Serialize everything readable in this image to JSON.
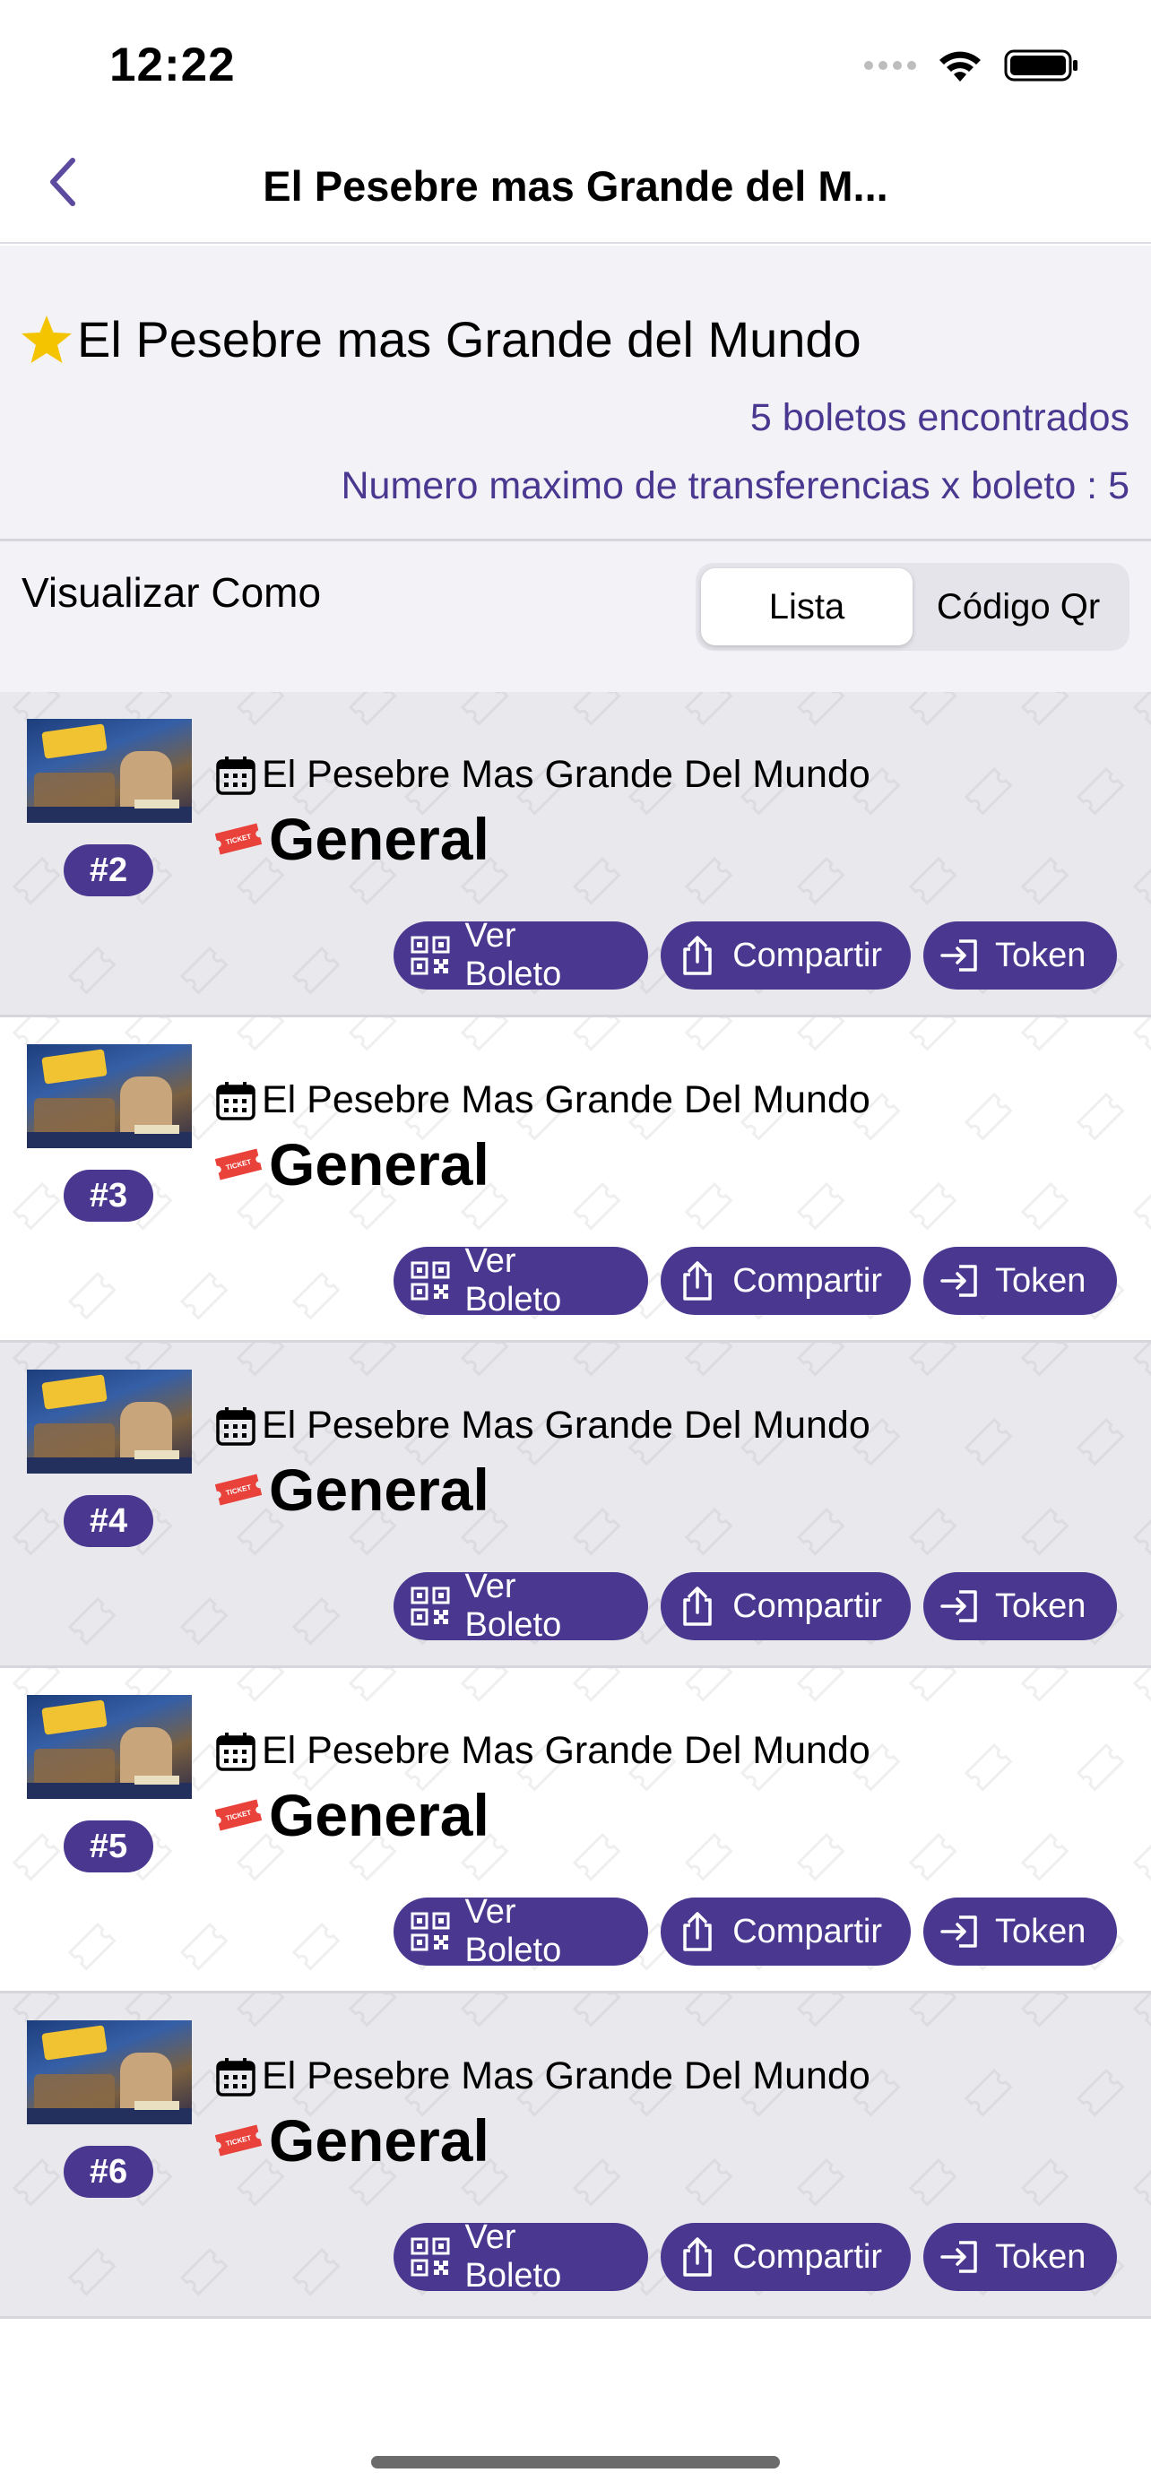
{
  "status_bar": {
    "time": "12:22"
  },
  "nav": {
    "title": "El Pesebre mas Grande del M..."
  },
  "header": {
    "event_title": "El Pesebre mas Grande del Mundo",
    "tickets_found": "5 boletos encontrados",
    "max_transfers": "Numero maximo de transferencias x boleto : 5"
  },
  "view_as": {
    "label": "Visualizar Como",
    "options": [
      "Lista",
      "Código Qr"
    ],
    "selected": "Lista"
  },
  "tickets": [
    {
      "number": "#2",
      "event": "El Pesebre Mas Grande Del Mundo",
      "category": "General"
    },
    {
      "number": "#3",
      "event": "El Pesebre Mas Grande Del Mundo",
      "category": "General"
    },
    {
      "number": "#4",
      "event": "El Pesebre Mas Grande Del Mundo",
      "category": "General"
    },
    {
      "number": "#5",
      "event": "El Pesebre Mas Grande Del Mundo",
      "category": "General"
    },
    {
      "number": "#6",
      "event": "El Pesebre Mas Grande Del Mundo",
      "category": "General"
    }
  ],
  "actions": {
    "view": "Ver Boleto",
    "share": "Compartir",
    "token": "Token"
  },
  "ticket_badge_text": "TICKET",
  "colors": {
    "accent": "#4a3890",
    "star": "#f5c400",
    "ticket_icon": "#e8423b"
  }
}
